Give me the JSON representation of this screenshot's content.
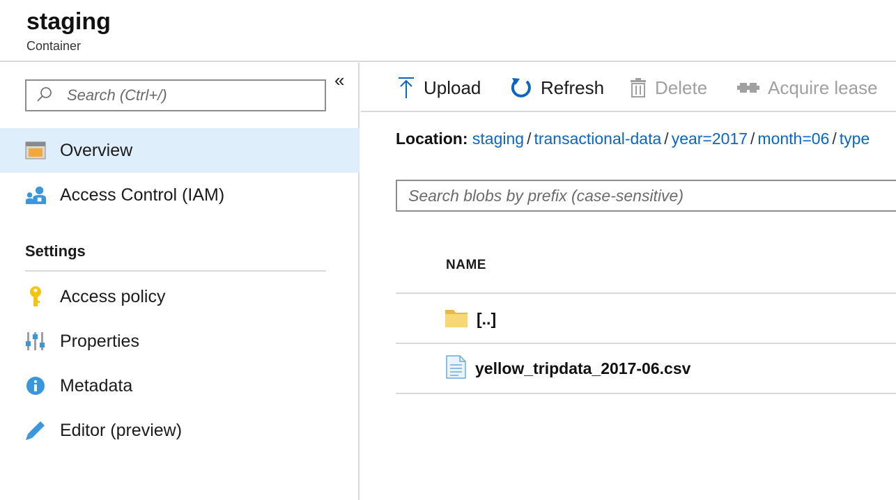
{
  "header": {
    "title": "staging",
    "subtitle": "Container"
  },
  "sidebar": {
    "collapse_label": "«",
    "search_placeholder": "Search (Ctrl+/)",
    "items": [
      {
        "label": "Overview",
        "icon": "overview-icon",
        "active": true
      },
      {
        "label": "Access Control (IAM)",
        "icon": "iam-icon"
      }
    ],
    "settings_heading": "Settings",
    "settings_items": [
      {
        "label": "Access policy",
        "icon": "key-icon"
      },
      {
        "label": "Properties",
        "icon": "properties-icon"
      },
      {
        "label": "Metadata",
        "icon": "info-icon"
      },
      {
        "label": "Editor (preview)",
        "icon": "pencil-icon"
      }
    ]
  },
  "toolbar": {
    "upload": "Upload",
    "refresh": "Refresh",
    "delete": "Delete",
    "acquire_lease": "Acquire lease"
  },
  "location": {
    "label": "Location:",
    "crumbs": [
      "staging",
      "transactional-data",
      "year=2017",
      "month=06",
      "type"
    ]
  },
  "blob_search_placeholder": "Search blobs by prefix (case-sensitive)",
  "table": {
    "column_name": "NAME",
    "rows": [
      {
        "name": "[..]",
        "icon": "folder-icon"
      },
      {
        "name": "yellow_tripdata_2017-06.csv",
        "icon": "file-icon"
      }
    ]
  },
  "colors": {
    "accent": "#0a66c2",
    "active_bg": "#deeefb",
    "disabled": "#a0a0a0",
    "divider": "#d8d8d8"
  }
}
